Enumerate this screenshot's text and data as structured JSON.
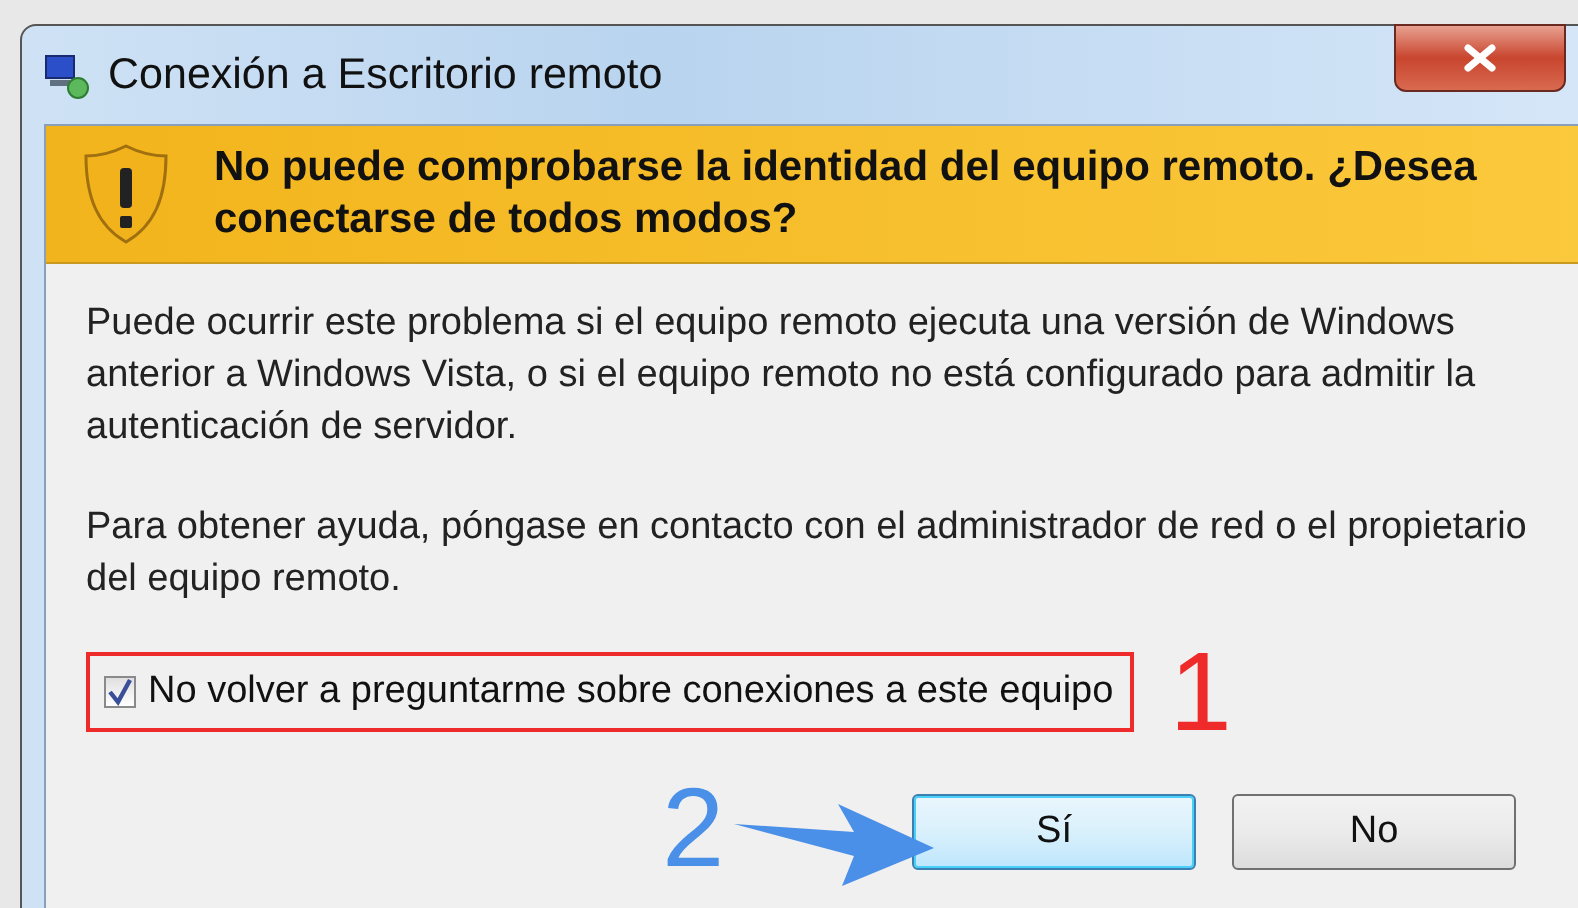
{
  "window": {
    "title": "Conexión a Escritorio remoto"
  },
  "warning": {
    "heading": "No puede comprobarse la identidad del equipo remoto. ¿Desea conectarse de todos modos?"
  },
  "paragraphs": [
    "Puede ocurrir este problema si el equipo remoto ejecuta una versión de Windows anterior a Windows Vista, o si el equipo remoto no está configurado para admitir la autenticación de servidor.",
    "Para obtener ayuda, póngase en contacto con el administrador de red o el propietario del equipo remoto."
  ],
  "checkbox": {
    "label": "No volver a preguntarme sobre conexiones a este equipo",
    "checked": true
  },
  "buttons": [
    {
      "label": "Sí",
      "selected": true
    },
    {
      "label": "No",
      "selected": false
    }
  ],
  "annotations": [
    {
      "label": "1",
      "color": "#ee2a2a"
    },
    {
      "label": "2",
      "color": "#4a8fe8"
    }
  ]
}
